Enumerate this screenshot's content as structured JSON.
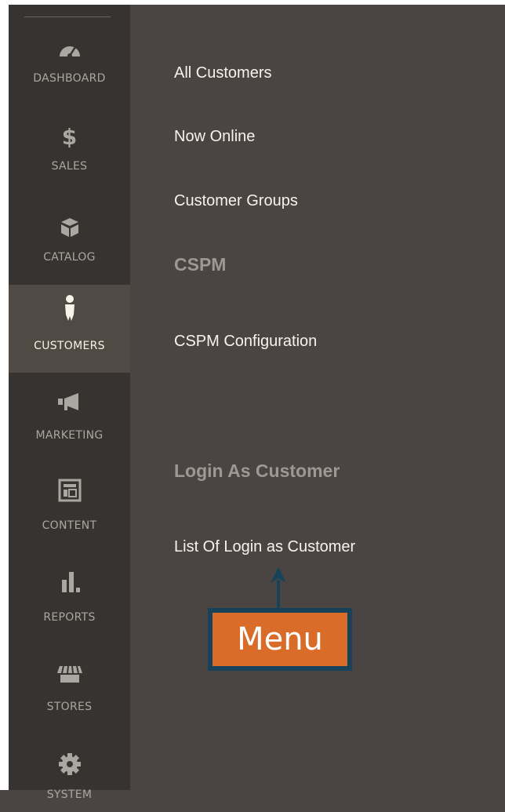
{
  "sidebar": {
    "items": [
      {
        "label": "DASHBOARD",
        "icon": "dashboard-icon"
      },
      {
        "label": "SALES",
        "icon": "dollar-icon"
      },
      {
        "label": "CATALOG",
        "icon": "box-icon"
      },
      {
        "label": "CUSTOMERS",
        "icon": "person-icon",
        "active": true
      },
      {
        "label": "MARKETING",
        "icon": "megaphone-icon"
      },
      {
        "label": "CONTENT",
        "icon": "layout-icon"
      },
      {
        "label": "REPORTS",
        "icon": "bar-chart-icon"
      },
      {
        "label": "STORES",
        "icon": "store-icon"
      },
      {
        "label": "SYSTEM",
        "icon": "gear-icon"
      }
    ]
  },
  "panel": {
    "links": [
      {
        "label": "All Customers"
      },
      {
        "label": "Now Online"
      },
      {
        "label": "Customer Groups"
      }
    ],
    "section_cspm": "CSPM",
    "cspm_config": "CSPM Configuration",
    "section_login": "Login As Customer",
    "login_list": "List Of Login as Customer"
  },
  "callout": {
    "label": "Menu"
  },
  "colors": {
    "active_bg": "#514943",
    "sidebar_bg": "#373330",
    "panel_bg": "#4a4542",
    "callout_fill": "#d96c28",
    "callout_border": "#17425a"
  }
}
